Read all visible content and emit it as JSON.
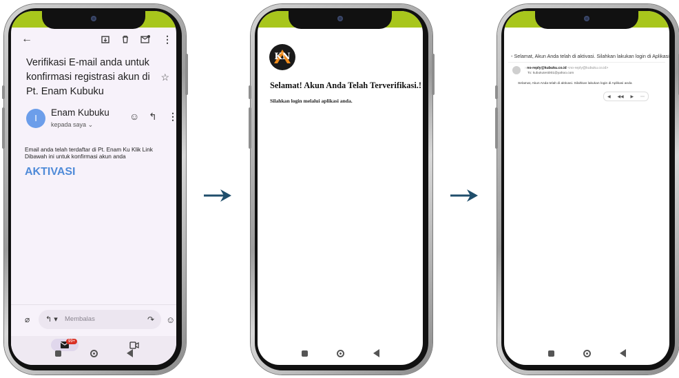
{
  "colors": {
    "status_bar": "#a8c61c",
    "link": "#4f8bd8",
    "arrow": "#1f4e6b"
  },
  "gmail": {
    "subject": "Verifikasi E-mail anda untuk konfirmasi registrasi akun di Pt. Enam Kubuku",
    "sender_initial": "I",
    "sender": "Enam Kubuku",
    "recipient": "kepada saya",
    "body": "Email anda telah terdaftar di  Pt. Enam Ku  Klik Link Dibawah ini untuk konfirmasi akun anda",
    "link": "AKTIVASI",
    "reply_placeholder": "Membalas",
    "badge": "99+",
    "icons": [
      "back-arrow-icon",
      "archive-icon",
      "delete-icon",
      "mark-unread-icon",
      "more-vert-icon",
      "star-icon",
      "emoji-icon",
      "reply-icon",
      "attach-icon",
      "forward-icon",
      "mail-icon",
      "video-icon"
    ]
  },
  "confirm": {
    "logo": "KN",
    "title": "Selamat! Akun Anda Telah Terverifikasi.!",
    "message": "Silahkan login melalui aplikasi anda."
  },
  "mailclient": {
    "subject": "Selamat, Akun Anda telah di aktivasi. Silahkan lakukan login di Aplikasi",
    "from_name": "no-reply@kubuku.co.id",
    "from_addr": "<no-reply@kubuku.co.id>",
    "to": "To: kubukutest001@yahoo.com",
    "body": "Selamat, Akun Anda telah di aktivasi. Silahkan lakukan login di Aplikasi anda"
  }
}
